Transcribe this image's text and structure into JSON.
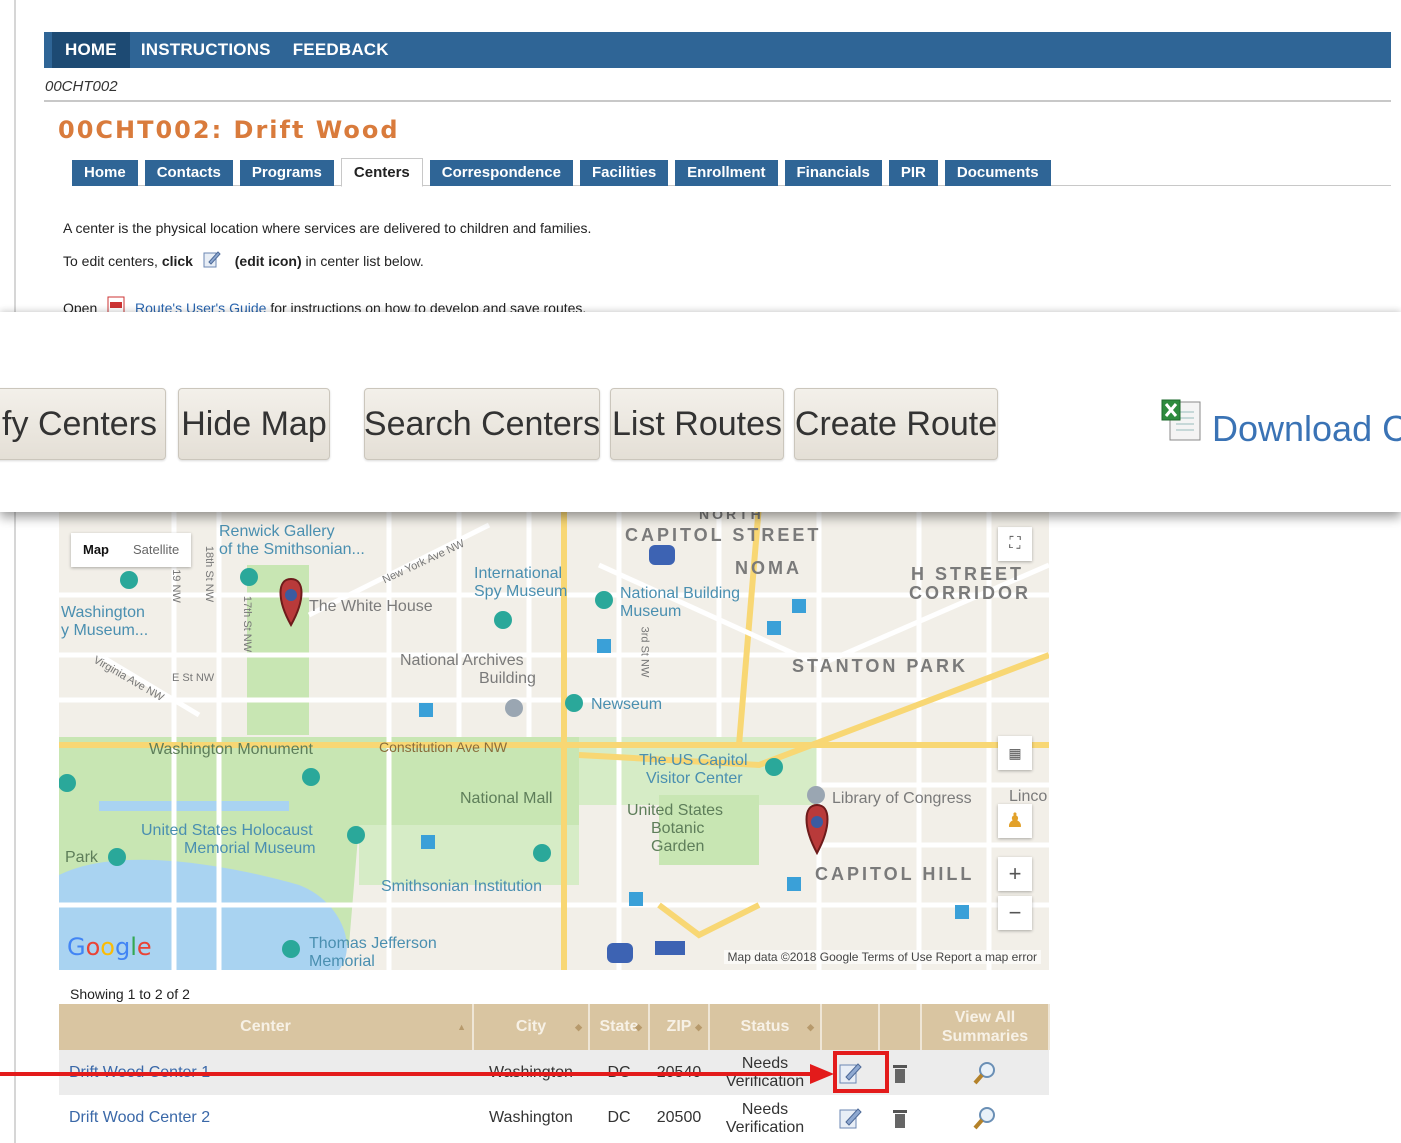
{
  "top_nav": {
    "items": [
      "HOME",
      "INSTRUCTIONS",
      "FEEDBACK"
    ]
  },
  "case_id": "00CHT002",
  "grantee_title": "00CHT002: Drift Wood",
  "tabs": [
    "Home",
    "Contacts",
    "Programs",
    "Centers",
    "Correspondence",
    "Facilities",
    "Enrollment",
    "Financials",
    "PIR",
    "Documents"
  ],
  "active_tab": "Centers",
  "intro": {
    "line1": "A center is the physical location where services are delivered to children and families.",
    "line2_pre": "To edit centers,",
    "line2_click": "click",
    "line2_icon_label": "(edit icon)",
    "line2_post": "in center list below.",
    "line3_pre": "Open",
    "line3_link": "Route's User's Guide",
    "line3_post": "for instructions on how to develop and save routes."
  },
  "toolbar": {
    "verify": "rify Centers",
    "hide_map": "Hide Map",
    "search": "Search Centers",
    "list_routes": "List Routes",
    "create_route": "Create Route",
    "download": "Download Ce"
  },
  "map": {
    "toggle_map": "Map",
    "toggle_satellite": "Satellite",
    "labels": {
      "renwick": "Renwick Gallery",
      "renwick2": "of the Smithsonian...",
      "intl_spy": "International",
      "intl_spy2": "Spy Museum",
      "nbm": "National Building",
      "nbm2": "Museum",
      "white_house": "The White House",
      "washington": "Washington",
      "washington2": "y Museum...",
      "archives": "National Archives",
      "archives2": "Building",
      "newseum": "Newseum",
      "monument": "Washington Monument",
      "constitution": "Constitution Ave NW",
      "capitol": "The US Capitol",
      "capitol2": "Visitor Center",
      "mall": "National Mall",
      "botanic": "United States",
      "botanic2": "Botanic",
      "botanic3": "Garden",
      "library": "Library of Congress",
      "holocaust": "United States Holocaust",
      "holocaust2": "Memorial Museum",
      "smithsonian": "Smithsonian Institution",
      "park": "Park",
      "jefferson": "Thomas Jefferson",
      "jefferson2": "Memorial",
      "north_capitol": "CAPITOL STREET",
      "north": "NORTH",
      "noma": "NOMA",
      "h_street": "H STREET",
      "corridor": "CORRIDOR",
      "stanton": "STANTON PARK",
      "capitol_hill": "CAPITOL HILL",
      "new_york_ave": "New York Ave NW",
      "virginia_ave": "Virginia Ave NW",
      "e_st": "E St NW",
      "st17": "17th St NW",
      "st18": "18th St NW",
      "st3": "3rd St NW",
      "st19": "19 NW",
      "lincoln": "Linco"
    },
    "google": "Google",
    "footer": "Map data ©2018 Google    Terms of Use    Report a map error"
  },
  "table": {
    "showing": "Showing 1 to 2 of 2",
    "headers": [
      "Center",
      "City",
      "State",
      "ZIP",
      "Status",
      "",
      "",
      "View All Summaries"
    ],
    "rows": [
      {
        "center": "Drift Wood Center 1",
        "city": "Washington",
        "state": "DC",
        "zip": "20540",
        "status": "Needs Verification"
      },
      {
        "center": "Drift Wood Center 2",
        "city": "Washington",
        "state": "DC",
        "zip": "20500",
        "status": "Needs Verification"
      }
    ]
  },
  "colors": {
    "nav_blue": "#2f6596",
    "title_orange": "#d97b3c",
    "table_header": "#d9c5a1",
    "highlight_red": "#e31b1b",
    "link_blue": "#3a68a8"
  },
  "icons": [
    "edit-icon",
    "trash-icon",
    "magnifier-icon",
    "pdf-icon",
    "excel-icon",
    "map-pin-icon",
    "fullscreen-icon",
    "pegman-icon",
    "zoom-in-icon",
    "zoom-out-icon"
  ]
}
